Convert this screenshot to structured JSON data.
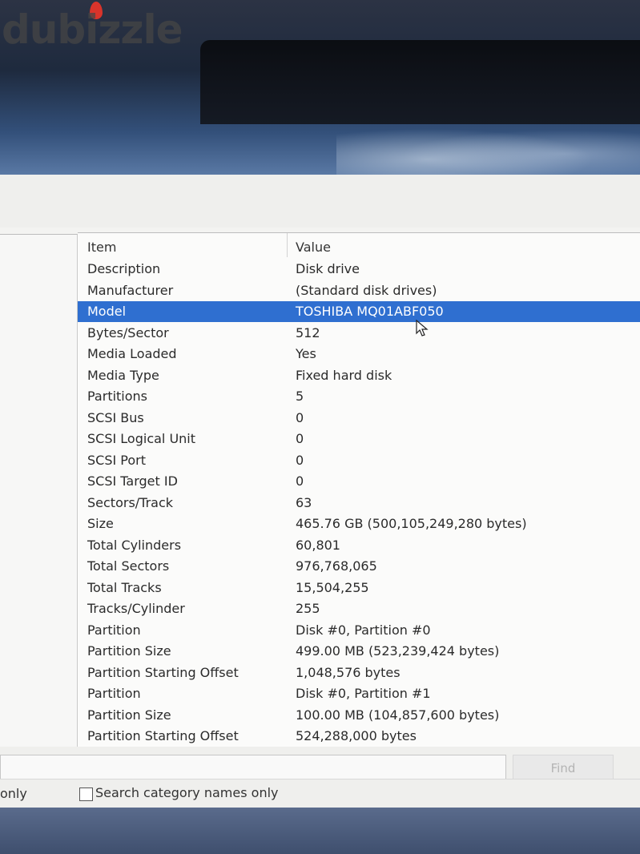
{
  "watermark": "dubizzle",
  "table": {
    "headers": {
      "item": "Item",
      "value": "Value"
    },
    "rows": [
      {
        "item": "Description",
        "value": "Disk drive"
      },
      {
        "item": "Manufacturer",
        "value": "(Standard disk drives)"
      },
      {
        "item": "Model",
        "value": "TOSHIBA MQ01ABF050",
        "selected": true
      },
      {
        "item": "Bytes/Sector",
        "value": "512"
      },
      {
        "item": "Media Loaded",
        "value": "Yes"
      },
      {
        "item": "Media Type",
        "value": "Fixed hard disk"
      },
      {
        "item": "Partitions",
        "value": "5"
      },
      {
        "item": "SCSI Bus",
        "value": "0"
      },
      {
        "item": "SCSI Logical Unit",
        "value": "0"
      },
      {
        "item": "SCSI Port",
        "value": "0"
      },
      {
        "item": "SCSI Target ID",
        "value": "0"
      },
      {
        "item": "Sectors/Track",
        "value": "63"
      },
      {
        "item": "Size",
        "value": "465.76 GB (500,105,249,280 bytes)"
      },
      {
        "item": "Total Cylinders",
        "value": "60,801"
      },
      {
        "item": "Total Sectors",
        "value": "976,768,065"
      },
      {
        "item": "Total Tracks",
        "value": "15,504,255"
      },
      {
        "item": "Tracks/Cylinder",
        "value": "255"
      },
      {
        "item": "Partition",
        "value": "Disk #0, Partition #0"
      },
      {
        "item": "Partition Size",
        "value": "499.00 MB (523,239,424 bytes)"
      },
      {
        "item": "Partition Starting Offset",
        "value": "1,048,576 bytes"
      },
      {
        "item": "Partition",
        "value": "Disk #0, Partition #1"
      },
      {
        "item": "Partition Size",
        "value": "100.00 MB (104,857,600 bytes)"
      },
      {
        "item": "Partition Starting Offset",
        "value": "524,288,000 bytes"
      }
    ]
  },
  "find": {
    "button_label": "Find",
    "input_value": ""
  },
  "footer": {
    "left_label": "only",
    "checkbox_label": "Search category names only",
    "checkbox_checked": false
  },
  "colors": {
    "selection": "#2f6fd0"
  }
}
